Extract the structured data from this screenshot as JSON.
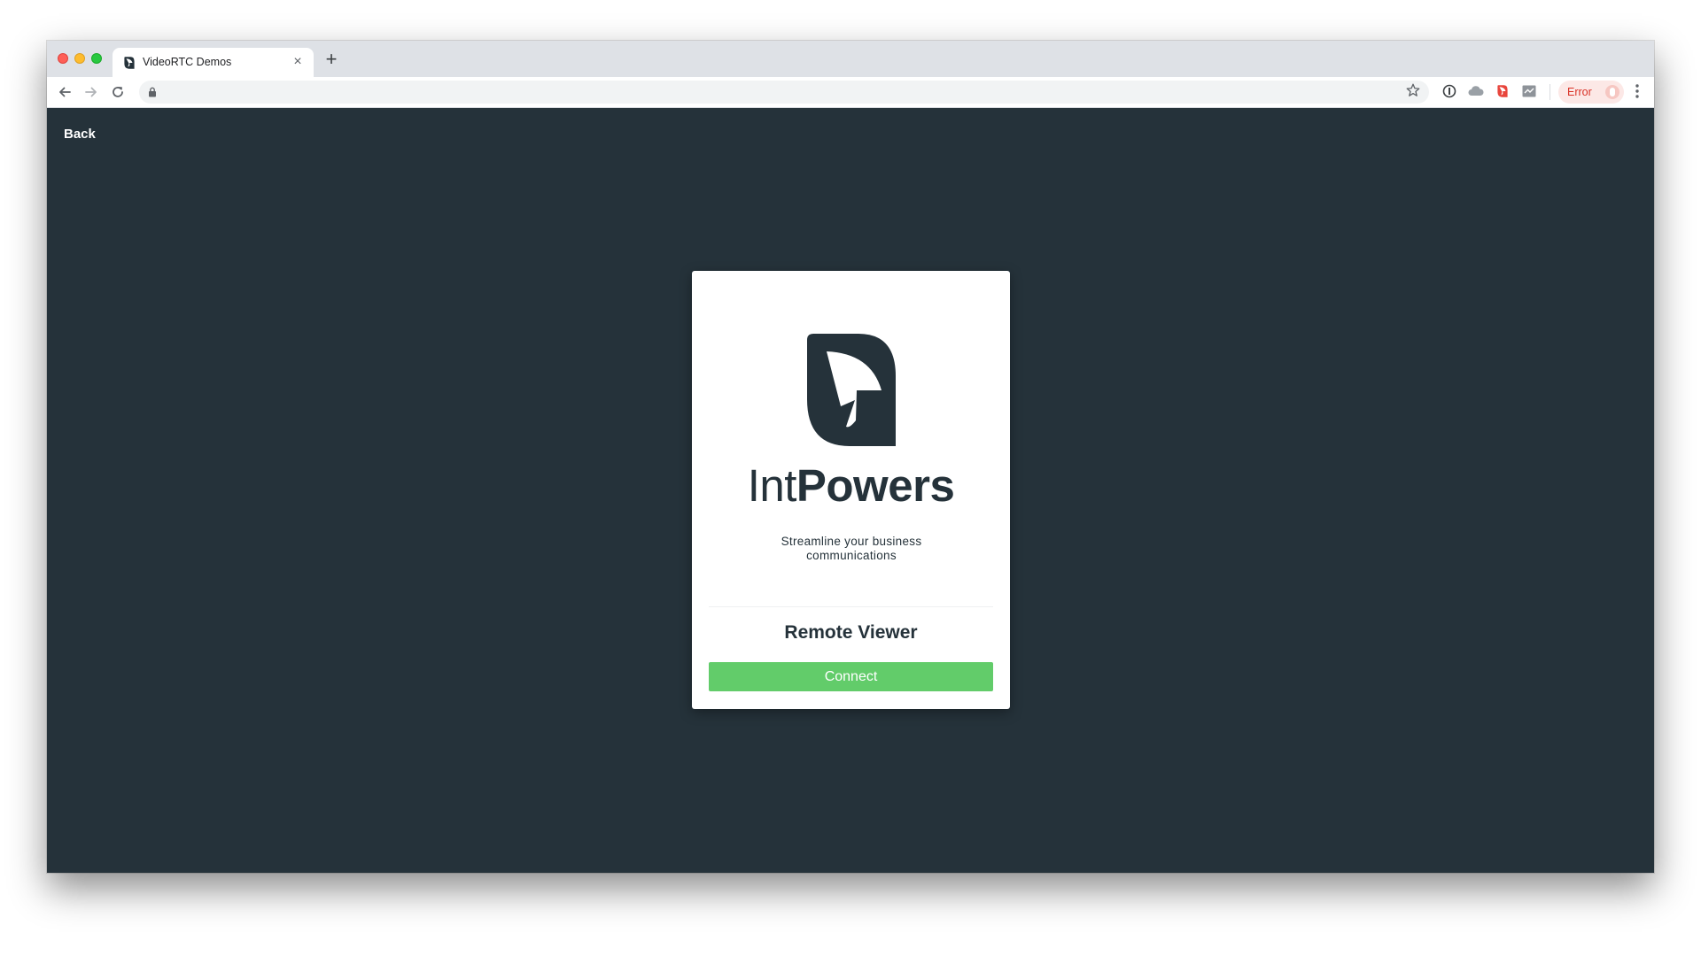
{
  "browser": {
    "tab_title": "VideoRTC Demos",
    "tab_close": "×",
    "new_tab": "+",
    "profile_status": "Error",
    "icons": [
      "back-arrow-icon",
      "forward-arrow-icon",
      "reload-icon",
      "lock-icon",
      "star-icon",
      "extension-icon",
      "menu-dots-icon"
    ]
  },
  "page": {
    "back_label": "Back",
    "brand": {
      "name_light": "Int",
      "name_bold": "Powers",
      "tagline": "Streamline your business communications"
    },
    "card_heading": "Remote Viewer",
    "connect_label": "Connect"
  },
  "colors": {
    "page_background": "#25323a",
    "brand_dark": "#25323a",
    "connect_green": "#62cc6a",
    "error_red": "#d93025"
  }
}
